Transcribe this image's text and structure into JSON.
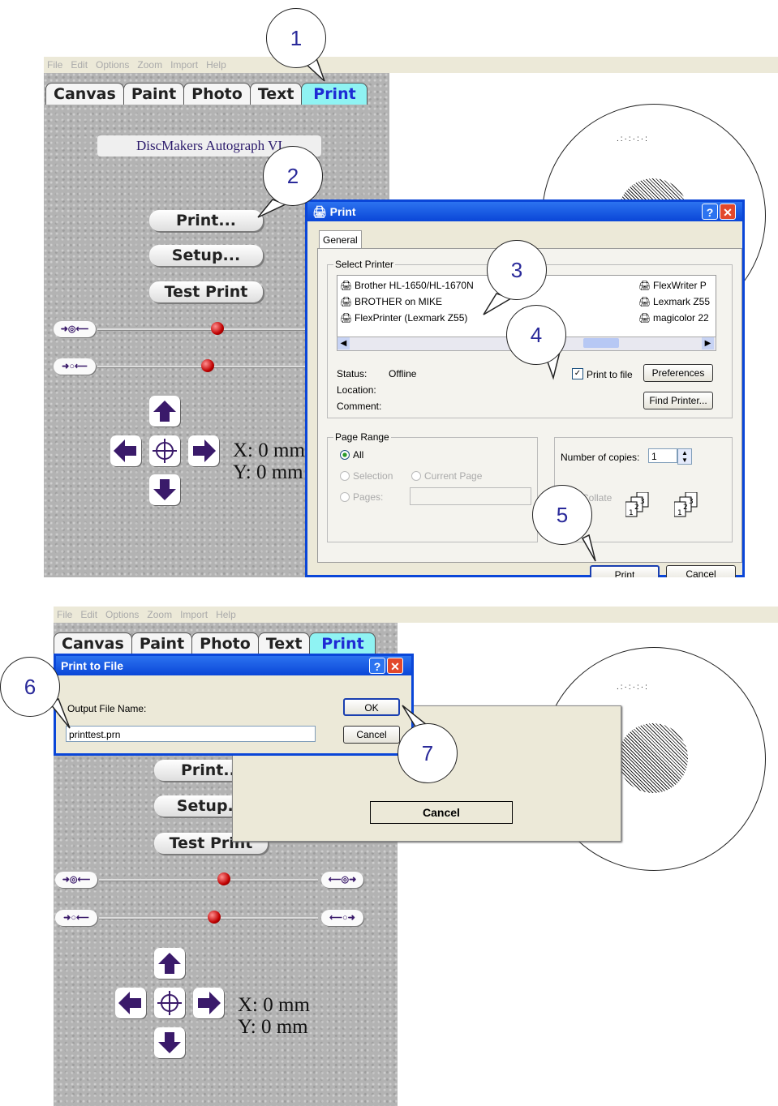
{
  "menu": [
    "File",
    "Edit",
    "Options",
    "Zoom",
    "Import",
    "Help"
  ],
  "menu_lower": [
    "File",
    "Edit",
    "Options",
    "Zoom",
    "Import",
    "Help"
  ],
  "tabs": [
    "Canvas",
    "Paint",
    "Photo",
    "Text",
    "Print"
  ],
  "printer_name": "DiscMakers Autograph VI",
  "buttons": {
    "print": "Print...",
    "setup": "Setup...",
    "test": "Test Print"
  },
  "buttons_lower": {
    "print": "Print...",
    "setup": "Setup...",
    "test": "Test Print"
  },
  "coords": {
    "x": "X: 0 mm",
    "y": "Y: 0 mm"
  },
  "callouts": [
    "1",
    "2",
    "3",
    "4",
    "5",
    "6",
    "7"
  ],
  "print_dialog": {
    "title": "Print",
    "tab": "General",
    "select_printer_label": "Select Printer",
    "printers_left": [
      "Brother HL-1650/HL-1670N",
      "BROTHER on MIKE",
      "FlexPrinter (Lexmark Z55)"
    ],
    "printers_right": [
      "FlexWriter P",
      "Lexmark Z55",
      "magicolor 22"
    ],
    "status_label": "Status:",
    "status_value": "Offline",
    "location_label": "Location:",
    "comment_label": "Comment:",
    "print_to_file": "Print to file",
    "preferences": "Preferences",
    "find_printer": "Find Printer...",
    "page_range": "Page Range",
    "all": "All",
    "selection": "Selection",
    "current_page": "Current Page",
    "pages": "Pages:",
    "copies_label": "Number of copies:",
    "copies_value": "1",
    "collate": "Collate",
    "print_btn": "Print",
    "cancel_btn": "Cancel"
  },
  "print_to_file_dialog": {
    "title": "Print to File",
    "output_label": "Output File Name:",
    "filename": "printtest.prn",
    "ok": "OK",
    "cancel": "Cancel"
  },
  "cancel_popup": {
    "cancel": "Cancel"
  },
  "colors": {
    "tab_active_bg": "#8ff3f3",
    "tab_active_text": "#1e2bd4",
    "xp_blue": "#0a46d8",
    "callout_text": "#2a2a9a"
  }
}
